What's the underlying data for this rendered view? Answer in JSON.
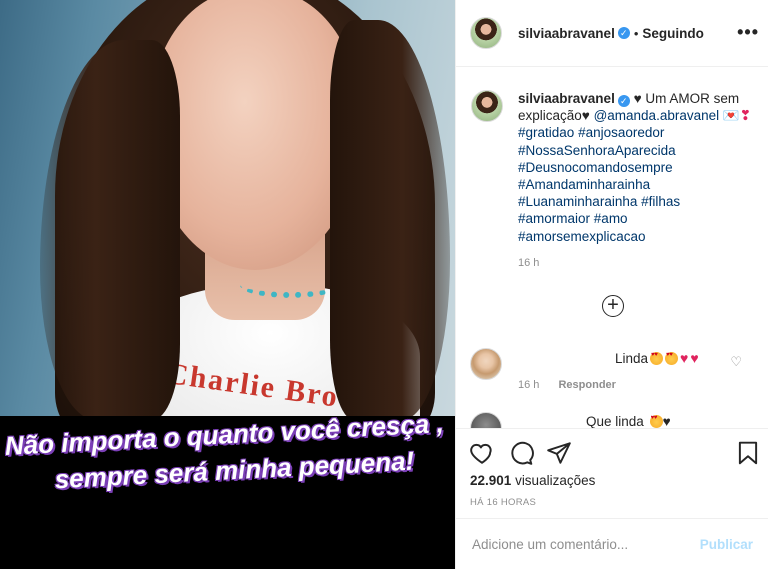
{
  "post_media": {
    "overlay_text_line1": "Não importa o quanto você cresça ,",
    "overlay_text_line2": "sempre será minha pequena!",
    "shirt_print": "Charlie Bro"
  },
  "header": {
    "username": "silviaabravanel",
    "separator": "•",
    "follow_status": "Seguindo",
    "more_icon": "more-options-icon"
  },
  "caption": {
    "username": "silviaabravanel",
    "text_start": "Um AMOR sem explicação",
    "mention": "@amanda.abravanel",
    "hashtags_inline": [
      "#gratidao",
      "#anjosaoredor"
    ],
    "hashtags": [
      "#NossaSenhoraAparecida",
      "#Deusnocomandosempre",
      "#Amandaminharainha"
    ],
    "hashtag_line_luana": "#Luanaminharainha",
    "hashtag_filhas": "#filhas",
    "hashtag_amormaior": "#amormaior",
    "hashtag_amo": "#amo",
    "hashtag_last": "#amorsemexplicacao",
    "time_ago": "16 h"
  },
  "load_more_icon": "plus-circle-icon",
  "comments": [
    {
      "text": "Linda",
      "time_ago": "16 h",
      "reply_label": "Responder",
      "like_icon": "heart-outline-icon"
    },
    {
      "text": "Que linda"
    }
  ],
  "actions": {
    "like_icon": "heart-outline-icon",
    "comment_icon": "comment-bubble-icon",
    "share_icon": "paper-plane-icon",
    "save_icon": "bookmark-icon",
    "views_count": "22.901",
    "views_label": "visualizações",
    "post_time": "HÁ 16 HORAS"
  },
  "add_comment": {
    "placeholder": "Adicione um comentário...",
    "publish_label": "Publicar"
  },
  "colors": {
    "hashtag": "#00376b",
    "verified": "#3897f0",
    "publish_disabled": "#b2dffc",
    "muted": "#8e8e8e",
    "overlay_outline": "#7b3fb7"
  }
}
